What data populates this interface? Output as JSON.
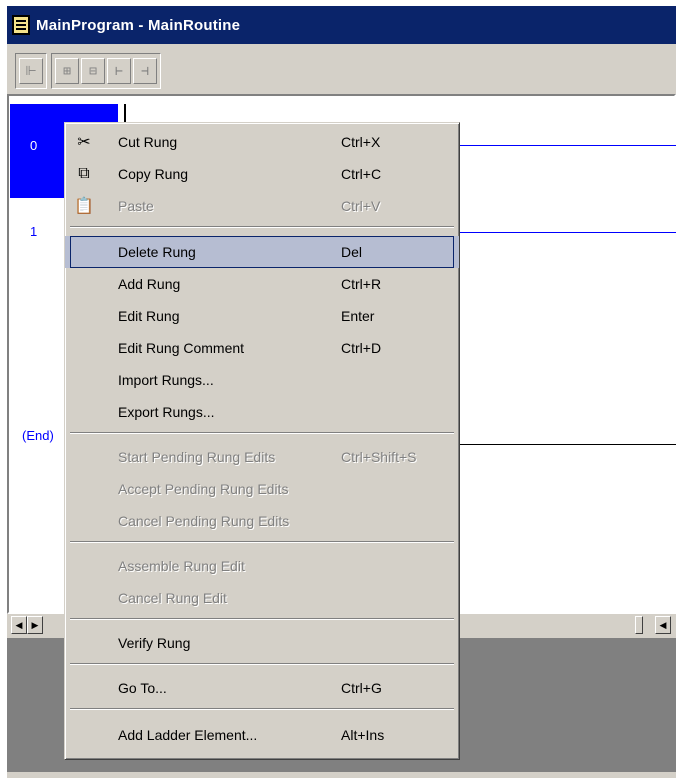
{
  "window": {
    "title": "MainProgram - MainRoutine"
  },
  "toolbar": {
    "buttons": [
      {
        "icon": "rung-icon",
        "glyph": "⊩"
      },
      {
        "icon": "branch-icon",
        "glyph": "⊞"
      },
      {
        "icon": "branch-level-icon",
        "glyph": "⊟"
      },
      {
        "icon": "xic-icon",
        "glyph": "⊢"
      },
      {
        "icon": "xio-icon",
        "glyph": "⊣"
      }
    ]
  },
  "ladder": {
    "rungs": [
      {
        "number": "0"
      },
      {
        "number": "1"
      }
    ],
    "end_label": "(End)"
  },
  "context_menu": {
    "items": [
      {
        "label": "Cut Rung",
        "shortcut": "Ctrl+X",
        "enabled": true,
        "icon": "scissors-icon",
        "glyph": "✂"
      },
      {
        "label": "Copy Rung",
        "shortcut": "Ctrl+C",
        "enabled": true,
        "icon": "copy-icon",
        "glyph": "⧉"
      },
      {
        "label": "Paste",
        "shortcut": "Ctrl+V",
        "enabled": false,
        "icon": "clipboard-icon",
        "glyph": "📋"
      },
      {
        "label": "Delete Rung",
        "shortcut": "Del",
        "enabled": true,
        "highlight": true
      },
      {
        "label": "Add Rung",
        "shortcut": "Ctrl+R",
        "enabled": true
      },
      {
        "label": "Edit Rung",
        "shortcut": "Enter",
        "enabled": true
      },
      {
        "label": "Edit Rung Comment",
        "shortcut": "Ctrl+D",
        "enabled": true
      },
      {
        "label": "Import Rungs...",
        "shortcut": "",
        "enabled": true
      },
      {
        "label": "Export Rungs...",
        "shortcut": "",
        "enabled": true
      },
      {
        "label": "Start Pending Rung Edits",
        "shortcut": "Ctrl+Shift+S",
        "enabled": false
      },
      {
        "label": "Accept Pending Rung Edits",
        "shortcut": "",
        "enabled": false
      },
      {
        "label": "Cancel Pending Rung Edits",
        "shortcut": "",
        "enabled": false
      },
      {
        "label": "Assemble Rung Edit",
        "shortcut": "",
        "enabled": false
      },
      {
        "label": "Cancel Rung Edit",
        "shortcut": "",
        "enabled": false
      },
      {
        "label": "Verify Rung",
        "shortcut": "",
        "enabled": true
      },
      {
        "label": "Go To...",
        "shortcut": "Ctrl+G",
        "enabled": true
      },
      {
        "label": "Add Ladder Element...",
        "shortcut": "Alt+Ins",
        "enabled": true
      }
    ]
  },
  "colors": {
    "title_bar": "#0a246a",
    "selection": "#0000ff",
    "menu_highlight": "#b6bdd2",
    "face": "#d4d0c8"
  }
}
